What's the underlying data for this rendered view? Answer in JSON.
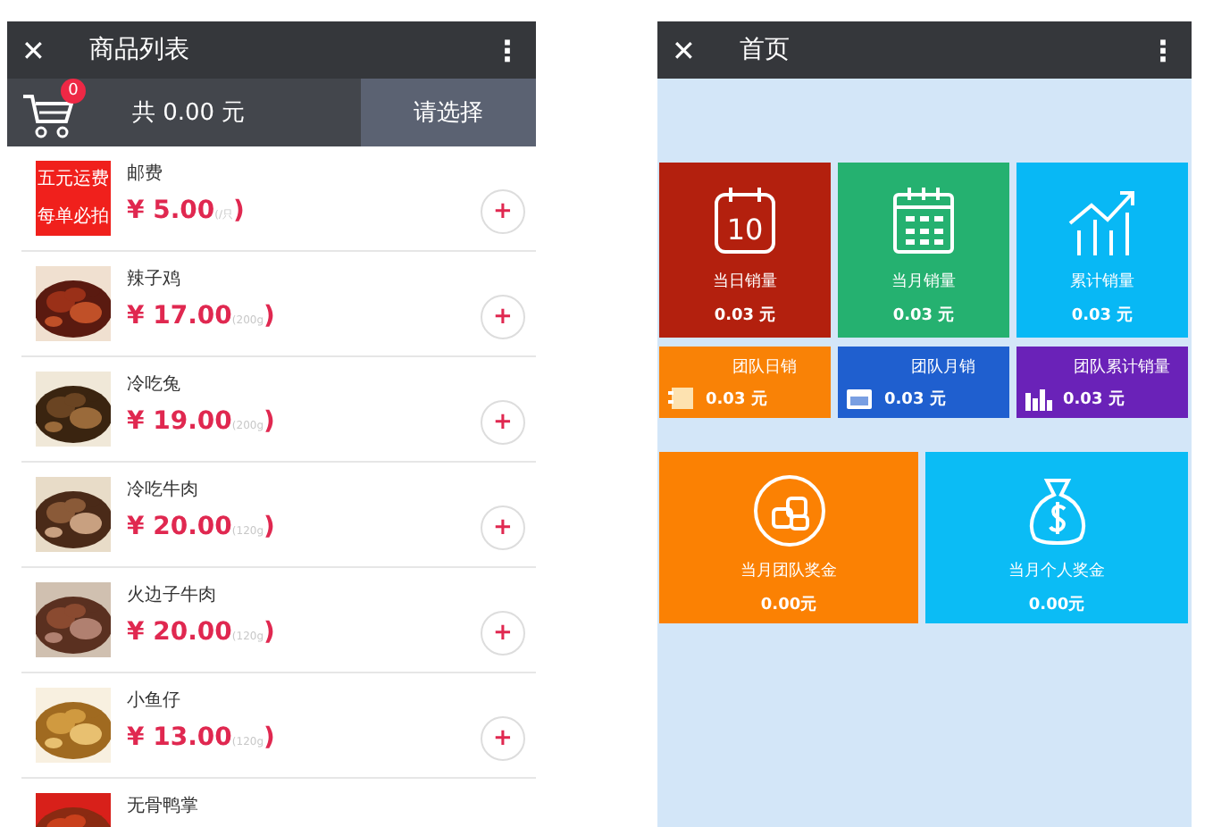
{
  "left_screen": {
    "title_bar": {
      "close": "✕",
      "title": "商品列表",
      "menu": "⋮"
    },
    "cart_bar": {
      "count": "0",
      "total": "共 0.00 元",
      "choose_button": "请选择"
    },
    "products": [
      {
        "kind": "promo",
        "promo_lines": [
          "五元运费",
          "每单必拍"
        ],
        "name": "邮费",
        "price": "¥ 5.00",
        "unit": "(/只",
        "bracket": ")",
        "add": "+"
      },
      {
        "kind": "picture",
        "name": "辣子鸡",
        "price": "¥ 17.00",
        "unit": "(200g",
        "bracket": ")",
        "add": "+"
      },
      {
        "kind": "picture",
        "name": "冷吃兔",
        "price": "¥ 19.00",
        "unit": "(200g",
        "bracket": ")",
        "add": "+"
      },
      {
        "kind": "picture",
        "name": "冷吃牛肉",
        "price": "¥ 20.00",
        "unit": "(120g",
        "bracket": ")",
        "add": "+"
      },
      {
        "kind": "picture",
        "name": "火边子牛肉",
        "price": "¥ 20.00",
        "unit": "(120g",
        "bracket": ")",
        "add": "+"
      },
      {
        "kind": "picture",
        "name": "小鱼仔",
        "price": "¥ 13.00",
        "unit": "(120g",
        "bracket": ")",
        "add": "+"
      },
      {
        "kind": "picture",
        "name": "无骨鸭掌"
      }
    ]
  },
  "right_screen": {
    "title_bar": {
      "close": "✕",
      "title": "首页",
      "menu": "⋮"
    },
    "large_tiles": [
      {
        "kind": "day",
        "icon_text": "10",
        "label": "当日销量",
        "value": "0.03 元",
        "color": "#b3200e"
      },
      {
        "kind": "month",
        "label": "当月销量",
        "value": "0.03 元",
        "color": "#25b170"
      },
      {
        "kind": "total",
        "label": "累计销量",
        "value": "0.03 元",
        "color": "#08b8f5"
      }
    ],
    "small_tiles": [
      {
        "kind": "day",
        "label": "团队日销",
        "value": "0.03 元",
        "color": "#f98206"
      },
      {
        "kind": "month",
        "label": "团队月销",
        "value": "0.03 元",
        "color": "#1f5fcf"
      },
      {
        "kind": "total",
        "label": "团队累计销量",
        "value": "0.03 元",
        "color": "#6a22b8"
      }
    ],
    "bonus_tiles": [
      {
        "kind": "team",
        "label": "当月团队奖金",
        "value": "0.00元",
        "color": "#fb8103"
      },
      {
        "kind": "personal",
        "label": "当月个人奖金",
        "value": "0.00元",
        "color": "#0bbcf5"
      }
    ]
  }
}
